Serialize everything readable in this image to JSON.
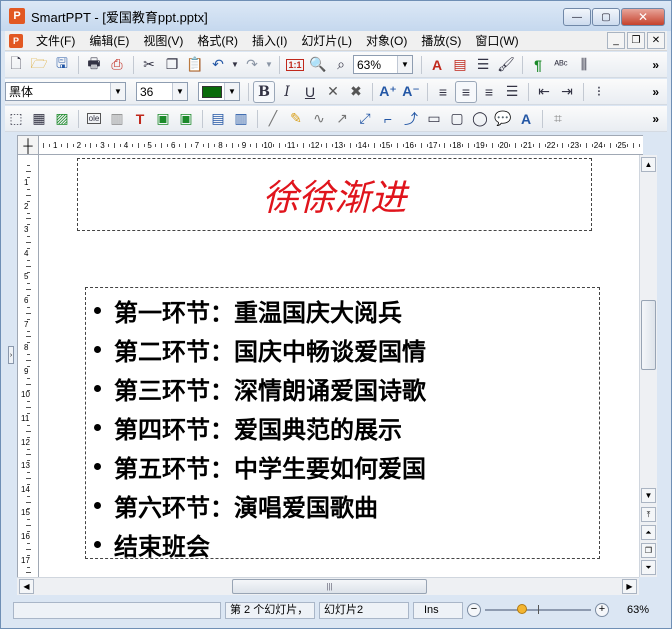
{
  "window": {
    "title": "SmartPPT - [爱国教育ppt.pptx]",
    "app_icon": "P",
    "buttons": {
      "minimize": "—",
      "maximize": "▢",
      "close": "✕"
    }
  },
  "menu": {
    "items": [
      "文件(F)",
      "编辑(E)",
      "视图(V)",
      "格式(R)",
      "插入(I)",
      "幻灯片(L)",
      "对象(O)",
      "播放(S)",
      "窗口(W)"
    ],
    "mdi": {
      "minimize": "_",
      "restore": "❐",
      "close": "✕"
    }
  },
  "toolbar1": {
    "icons": [
      "new-file-icon",
      "open-folder-icon",
      "save-icon",
      "print-icon",
      "pdf-icon",
      "cut-icon",
      "copy-icon",
      "paste-icon",
      "undo-icon",
      "redo-icon",
      "slide-number-icon",
      "find-icon",
      "zoom-icon"
    ],
    "slide_number_glyph": "1:1",
    "zoom_value": "63%"
  },
  "toolbar2": {
    "font_name": "黑体",
    "font_size": "36",
    "font_color": "#0a6b0a",
    "bold_label": "B",
    "italic_label": "I",
    "underline_label": "U"
  },
  "toolbar3": {
    "icons": [
      "select-all-icon",
      "table-icon",
      "image-icon",
      "ole-icon",
      "chart-icon",
      "textbox-icon",
      "shape-icon",
      "group-icon",
      "align-icon",
      "line-icon",
      "pen-icon",
      "curve-icon",
      "arrow-icon",
      "connector-icon",
      "rect-icon",
      "rounded-rect-icon",
      "ellipse-icon",
      "callout-icon",
      "wordart-icon",
      "crop-icon"
    ],
    "ole_label": "ole"
  },
  "ruler": {
    "h_numbers": [
      "1",
      "2",
      "3",
      "4",
      "5",
      "6",
      "7",
      "8",
      "9",
      "10",
      "11",
      "12",
      "13",
      "14",
      "15",
      "16",
      "17",
      "18",
      "19",
      "20",
      "21",
      "22",
      "23",
      "24",
      "25"
    ],
    "v_numbers": [
      "1",
      "2",
      "3",
      "4",
      "5",
      "6",
      "7",
      "8",
      "9",
      "10",
      "11",
      "12",
      "13",
      "14",
      "15",
      "16",
      "17"
    ]
  },
  "slide": {
    "title": "徐徐渐进",
    "title_color": "#e0141c",
    "bullets": [
      "第一环节：重温国庆大阅兵",
      "第二环节：国庆中畅谈爱国情",
      "第三环节：深情朗诵爱国诗歌",
      "第四环节：爱国典范的展示",
      "第五环节：中学生要如何爱国",
      "第六环节：演唱爱国歌曲",
      "结束班会"
    ]
  },
  "statusbar": {
    "slide_info": "第 2 个幻灯片，",
    "slide_name": "幻灯片2",
    "mode": "Ins",
    "zoom": "63%",
    "zoom_minus": "−",
    "zoom_plus": "+"
  }
}
